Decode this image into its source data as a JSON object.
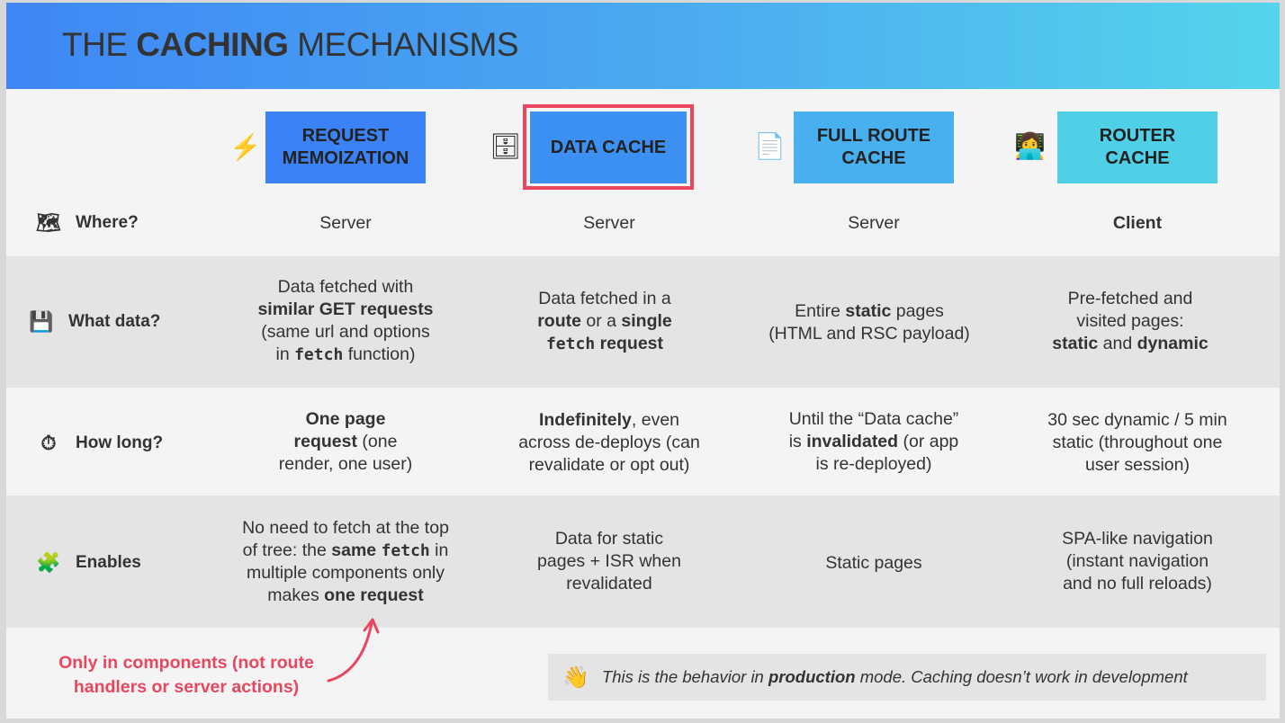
{
  "header": {
    "title_pre": "THE ",
    "title_bold": "CACHING",
    "title_post": " MECHANISMS",
    "gradient": [
      "#3f87f5",
      "#55d4ec"
    ]
  },
  "columns": [
    {
      "icon": "⚡",
      "icon_name": "lightning-icon",
      "label_line1": "REQUEST",
      "label_line2": "MEMOIZATION",
      "color": "#3b82f6"
    },
    {
      "icon": "🗄",
      "icon_name": "file-cabinet-icon",
      "label_line1": "DATA CACHE",
      "label_line2": "",
      "color": "#3b90f2",
      "highlight": "#e8475f"
    },
    {
      "icon": "📄",
      "icon_name": "page-icon",
      "label_line1": "FULL ROUTE",
      "label_line2": "CACHE",
      "color": "#48b0ef"
    },
    {
      "icon": "👩‍💻",
      "icon_name": "technologist-icon",
      "label_line1": "ROUTER",
      "label_line2": "CACHE",
      "color": "#50d0e6"
    }
  ],
  "rows": {
    "where": {
      "icon": "🗺",
      "icon_name": "map-icon",
      "label": "Where?"
    },
    "what": {
      "icon": "💾",
      "icon_name": "floppy-disk-icon",
      "label": "What data?"
    },
    "howlong": {
      "icon": "⏱",
      "icon_name": "stopwatch-icon",
      "label": "How long?"
    },
    "enables": {
      "icon": "🧩",
      "icon_name": "puzzle-icon",
      "label": "Enables"
    }
  },
  "cells": {
    "where": [
      "Server",
      "Server",
      "Server",
      "Client"
    ],
    "what": {
      "c1": {
        "l1": "Data fetched with",
        "l2": "similar GET requests",
        "l3": "(same url and options",
        "l4a": "in ",
        "l4code": "fetch",
        "l4b": " function)"
      },
      "c2": {
        "l1": "Data fetched in a",
        "l2a": "route",
        "l2b": " or a ",
        "l2c": "single",
        "l3code": "fetch",
        "l3b": " request"
      },
      "c3": {
        "l1a": "Entire ",
        "l1b": "static",
        "l1c": " pages",
        "l2": "(HTML and RSC payload)"
      },
      "c4": {
        "l1": "Pre-fetched and",
        "l2": "visited pages:",
        "l3a": "static",
        "l3b": " and ",
        "l3c": "dynamic"
      }
    },
    "howlong": {
      "c1": {
        "l1": "One page",
        "l2a": "request",
        "l2b": " (one",
        "l3": "render, one user)"
      },
      "c2": {
        "l1a": "Indefinitely",
        "l1b": ", even",
        "l2": "across de-deploys (can",
        "l3": "revalidate or opt out)"
      },
      "c3": {
        "l1": "Until the “Data cache”",
        "l2a": "is ",
        "l2b": "invalidated",
        "l2c": " (or app",
        "l3": "is re-deployed)"
      },
      "c4": {
        "l1": "30 sec dynamic / 5 min",
        "l2": "static (throughout one",
        "l3": "user session)"
      }
    },
    "enables": {
      "c1": {
        "l1": "No need to fetch at the top",
        "l2a": "of tree: the ",
        "l2b": "same",
        "l2code": "fetch",
        "l2c": " in",
        "l3": "multiple components only",
        "l4a": "makes ",
        "l4b": "one request"
      },
      "c2": {
        "l1": "Data for static",
        "l2": "pages + ISR when",
        "l3": "revalidated"
      },
      "c3": {
        "l1": "Static pages"
      },
      "c4": {
        "l1": "SPA-like navigation",
        "l2": "(instant navigation",
        "l3": "and no full reloads)"
      }
    }
  },
  "footnote": {
    "line1": "Only in components (not route",
    "line2": "handlers or server actions)",
    "color": "#e8475f"
  },
  "callout": {
    "icon": "👋",
    "icon_name": "waving-hand-icon",
    "text_a": "This is the behavior in ",
    "text_b": "production",
    "text_c": " mode. Caching doesn’t work in development"
  }
}
